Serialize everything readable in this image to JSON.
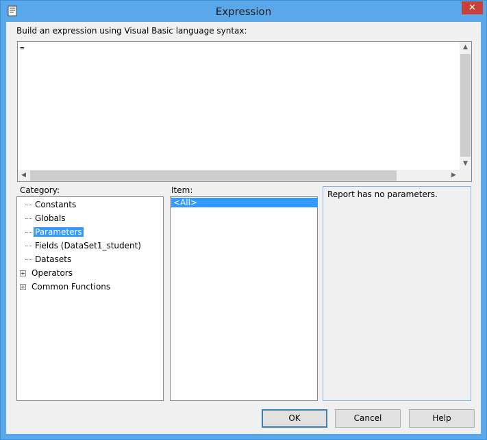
{
  "window": {
    "title": "Expression",
    "close_glyph": "✕",
    "app_icon": "expression-dialog-icon"
  },
  "prompt": "Build an expression using Visual Basic language syntax:",
  "editor": {
    "value": "="
  },
  "category": {
    "label": "Category:",
    "items": [
      {
        "label": "Constants",
        "expandable": false,
        "selected": false
      },
      {
        "label": "Globals",
        "expandable": false,
        "selected": false
      },
      {
        "label": "Parameters",
        "expandable": false,
        "selected": true
      },
      {
        "label": "Fields (DataSet1_student)",
        "expandable": false,
        "selected": false
      },
      {
        "label": "Datasets",
        "expandable": false,
        "selected": false
      },
      {
        "label": "Operators",
        "expandable": true,
        "selected": false
      },
      {
        "label": "Common Functions",
        "expandable": true,
        "selected": false
      }
    ]
  },
  "item": {
    "label": "Item:",
    "items": [
      "<All>"
    ]
  },
  "description": "Report has no parameters.",
  "buttons": {
    "ok": "OK",
    "cancel": "Cancel",
    "help": "Help"
  },
  "colors": {
    "titlebar": "#5aa7ea",
    "selection": "#3399ff",
    "close": "#c7403a"
  }
}
